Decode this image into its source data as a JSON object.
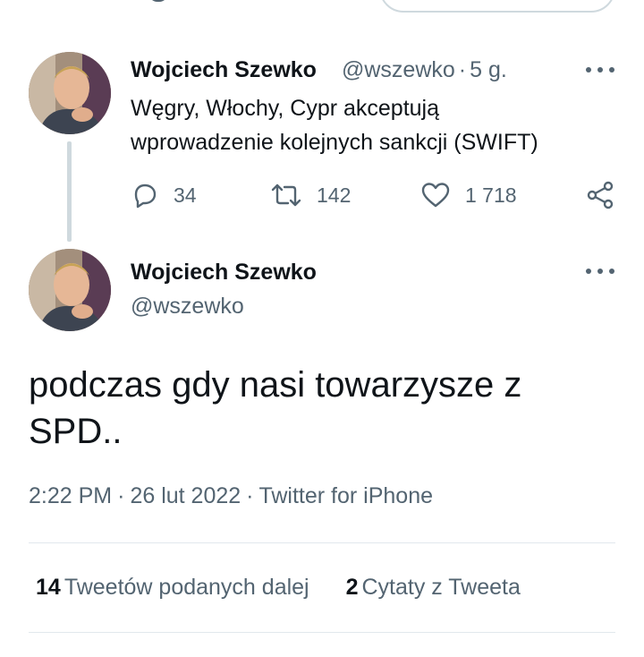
{
  "tweet_parent": {
    "author_name": "Wojciech Szewko",
    "handle": "@wszewko",
    "separator": "·",
    "time_ago": "5 g.",
    "text_line1": "Węgry, Włochy, Cypr akceptują",
    "text_line2": "wprowadzenie kolejnych sankcji (SWIFT)",
    "replies": "34",
    "retweets": "142",
    "likes": "1 718",
    "icons": [
      "reply-icon",
      "retweet-icon",
      "like-icon",
      "share-icon",
      "more-icon"
    ]
  },
  "tweet_main": {
    "author_name": "Wojciech Szewko",
    "handle": "@wszewko",
    "text_line1": "podczas gdy nasi towarzysze z",
    "text_line2": "SPD..",
    "time": "2:22 PM",
    "separator": "·",
    "date": "26 lut 2022",
    "source": "Twitter for iPhone"
  },
  "stats": {
    "retweets_count": "14",
    "retweets_label": "Tweetów podanych dalej",
    "quotes_count": "2",
    "quotes_label": "Cytaty z Tweeta"
  },
  "colors": {
    "text": "#0f1419",
    "muted": "#536471",
    "border": "#cfd9de",
    "divider": "#e1e8ed"
  }
}
